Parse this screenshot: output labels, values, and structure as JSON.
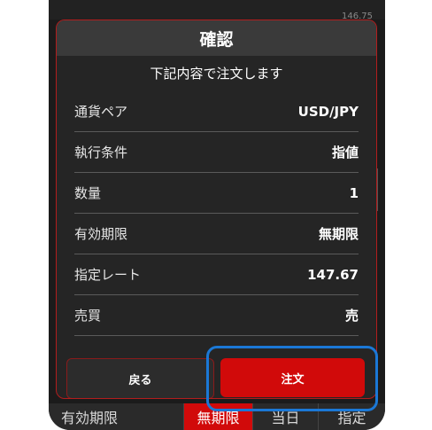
{
  "background": {
    "price_tick": "146.75",
    "bottom_label": "有効期限",
    "bottom_segments": [
      {
        "label": "無期限",
        "active": true
      },
      {
        "label": "当日",
        "active": false
      },
      {
        "label": "指定",
        "active": false
      }
    ]
  },
  "dialog": {
    "title": "確認",
    "subtitle": "下記内容で注文します",
    "rows": [
      {
        "label": "通貨ペア",
        "value": "USD/JPY"
      },
      {
        "label": "執行条件",
        "value": "指値"
      },
      {
        "label": "数量",
        "value": "1"
      },
      {
        "label": "有効期限",
        "value": "無期限"
      },
      {
        "label": "指定レート",
        "value": "147.67"
      },
      {
        "label": "売買",
        "value": "売"
      }
    ],
    "back_label": "戻る",
    "order_label": "注文"
  },
  "colors": {
    "accent_red": "#d10a0a",
    "highlight_blue": "#1b78d6",
    "dialog_bg": "#252525"
  }
}
